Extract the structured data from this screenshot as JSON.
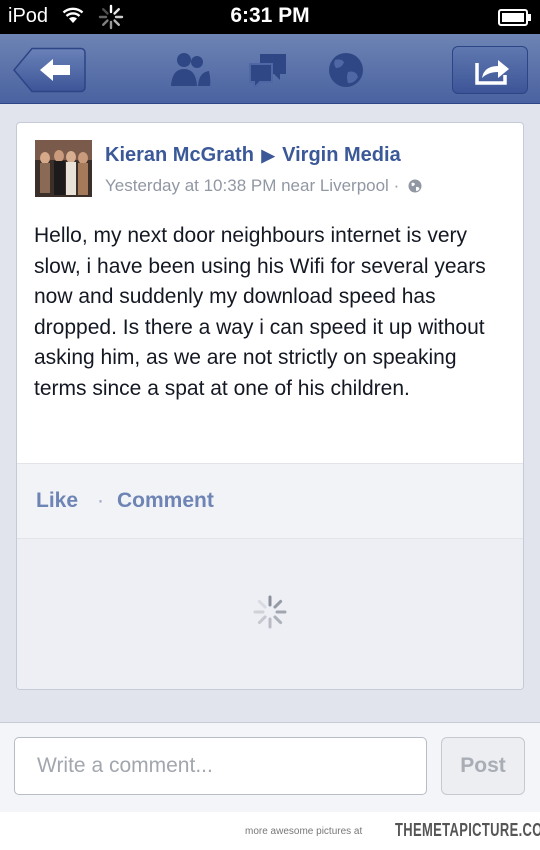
{
  "status_bar": {
    "carrier": "iPod",
    "time": "6:31 PM"
  },
  "nav": {
    "icons": [
      "back-arrow-icon",
      "friends-icon",
      "messages-icon",
      "notifications-globe-icon",
      "share-icon"
    ],
    "accent": "#3b5998"
  },
  "post": {
    "author": "Kieran McGrath",
    "target": "Virgin Media",
    "timestamp": "Yesterday at 10:38 PM near Liverpool",
    "privacy_separator": "·",
    "body": "Hello, my next door neighbours internet is very slow, i have been using his Wifi for several years now and suddenly my download speed has dropped. Is there a way i can speed it up without asking him, as we are not strictly on speaking terms since a spat at one of his children."
  },
  "actions": {
    "like": "Like",
    "separator": "·",
    "comment": "Comment"
  },
  "composer": {
    "placeholder": "Write a comment...",
    "post_label": "Post"
  },
  "footer": {
    "lead": "more awesome pictures at",
    "brand": "THEMETAPICTURE.COM"
  }
}
